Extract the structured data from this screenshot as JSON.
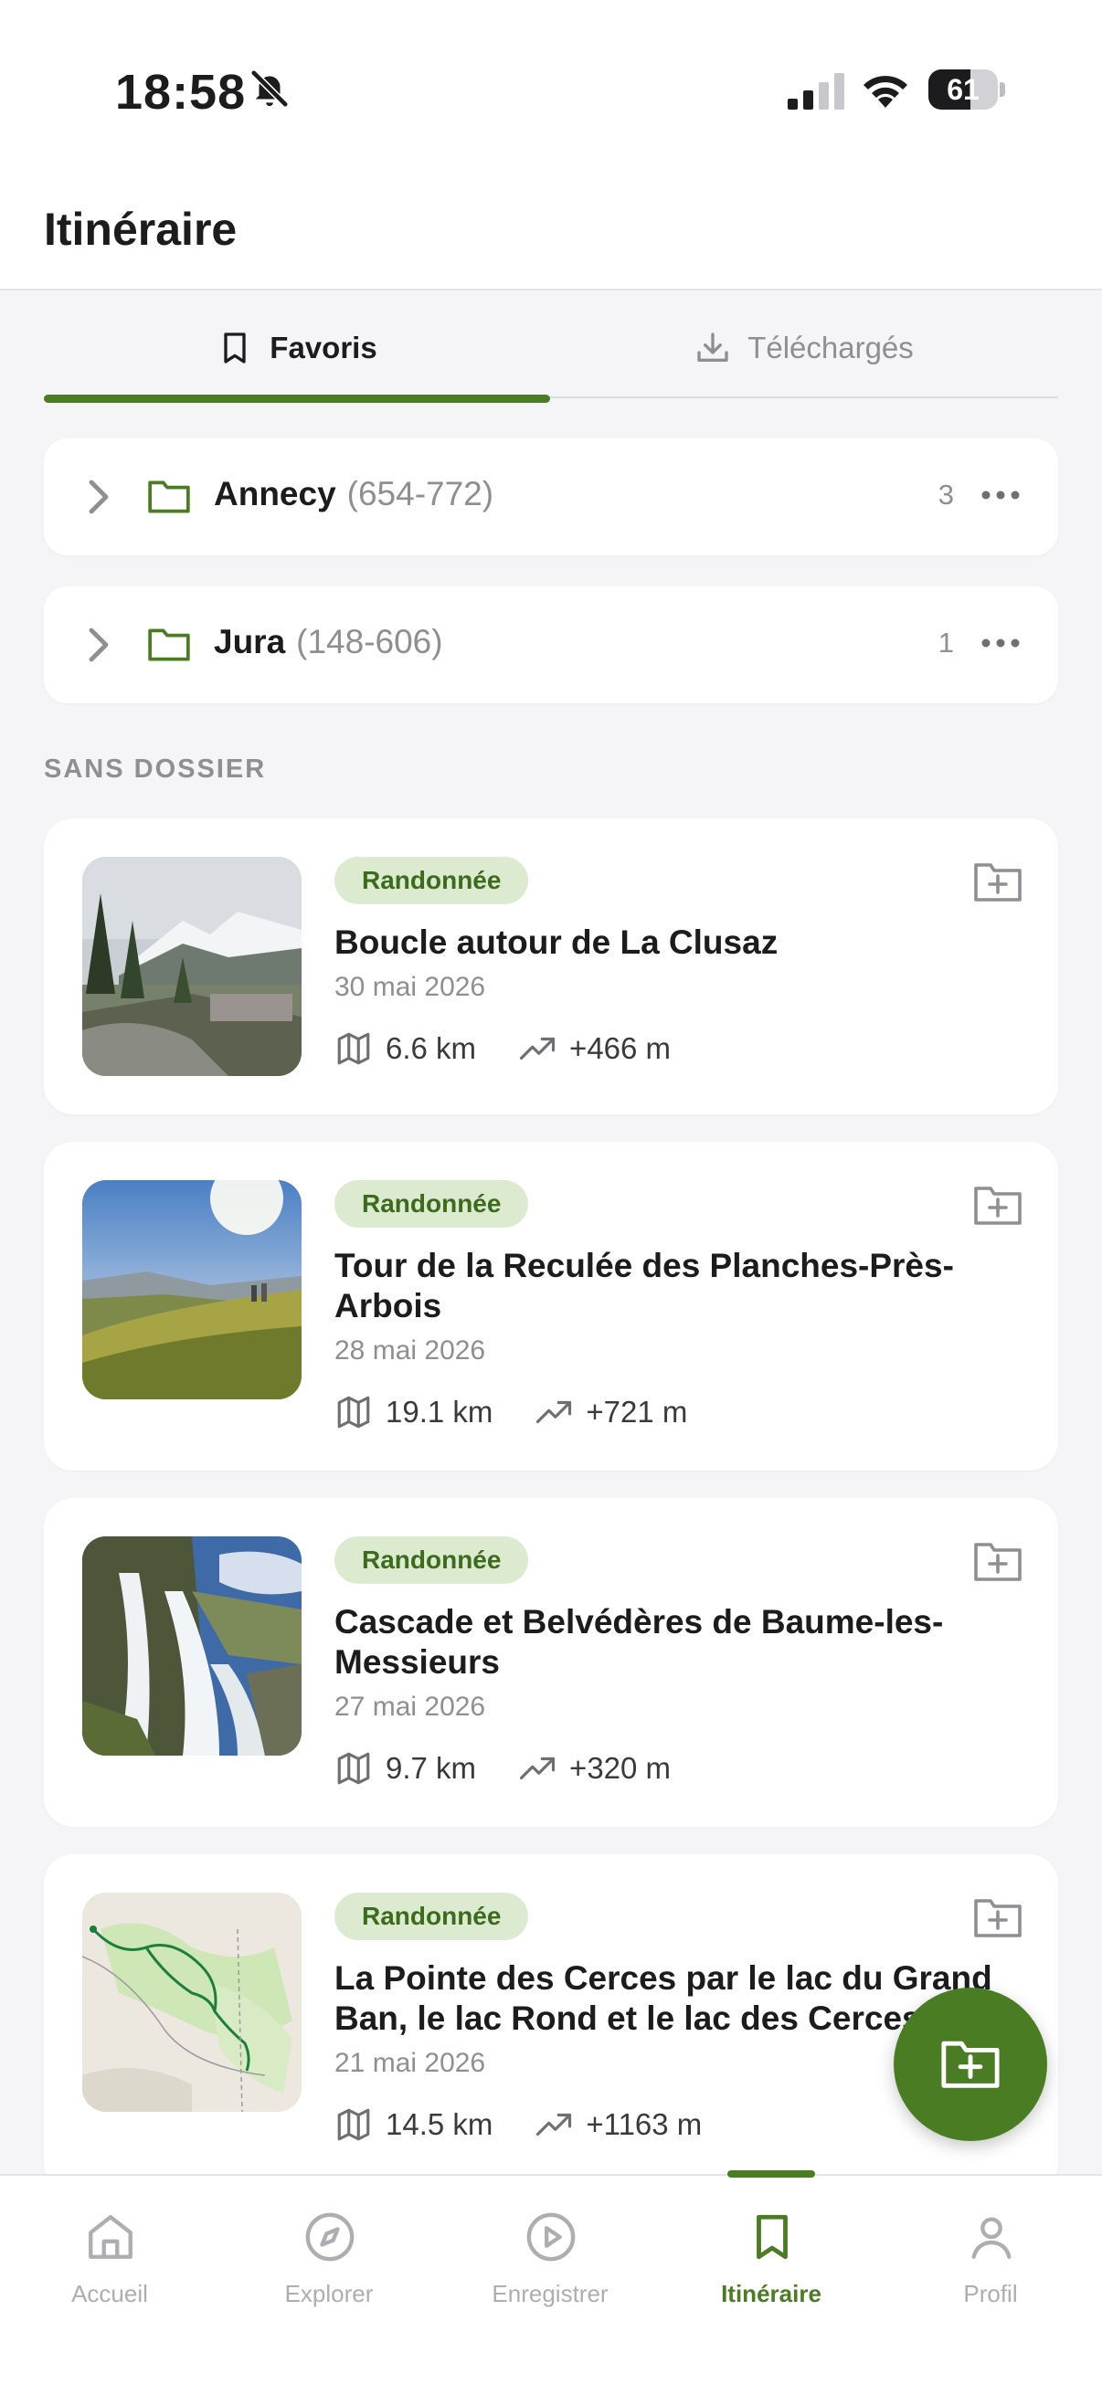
{
  "status": {
    "time": "18:58",
    "battery": "61",
    "battery_level": 0.61
  },
  "header": {
    "title": "Itinéraire"
  },
  "tabs": [
    {
      "label": "Favoris",
      "icon": "bookmark-icon",
      "active": true
    },
    {
      "label": "Téléchargés",
      "icon": "download-icon",
      "active": false
    }
  ],
  "folders": [
    {
      "name": "Annecy",
      "range": "(654-772)",
      "count": "3"
    },
    {
      "name": "Jura",
      "range": "(148-606)",
      "count": "1"
    }
  ],
  "section_label": "SANS DOSSIER",
  "routes": [
    {
      "tag": "Randonnée",
      "title": "Boucle autour de La Clusaz",
      "date": "30 mai 2026",
      "distance": "6.6 km",
      "elevation": "+466 m"
    },
    {
      "tag": "Randonnée",
      "title": "Tour de la Reculée des Planches-Près-Arbois",
      "date": "28 mai 2026",
      "distance": "19.1 km",
      "elevation": "+721 m"
    },
    {
      "tag": "Randonnée",
      "title": "Cascade et Belvédères de Baume-les-Messieurs",
      "date": "27 mai 2026",
      "distance": "9.7 km",
      "elevation": "+320 m"
    },
    {
      "tag": "Randonnée",
      "title": "La Pointe des Cerces par le lac du Grand Ban, le lac Rond et le lac des Cerces",
      "date": "21 mai 2026",
      "distance": "14.5 km",
      "elevation": "+1163 m"
    }
  ],
  "nav": [
    {
      "label": "Accueil",
      "icon": "home-icon",
      "active": false
    },
    {
      "label": "Explorer",
      "icon": "compass-icon",
      "active": false
    },
    {
      "label": "Enregistrer",
      "icon": "record-play-icon",
      "active": false
    },
    {
      "label": "Itinéraire",
      "icon": "bookmark-icon",
      "active": true
    },
    {
      "label": "Profil",
      "icon": "profile-icon",
      "active": false
    }
  ],
  "colors": {
    "accent": "#4a7c23",
    "tag_bg": "#dcebd0",
    "tag_text": "#3d6b1d",
    "background": "#f5f5f7"
  }
}
